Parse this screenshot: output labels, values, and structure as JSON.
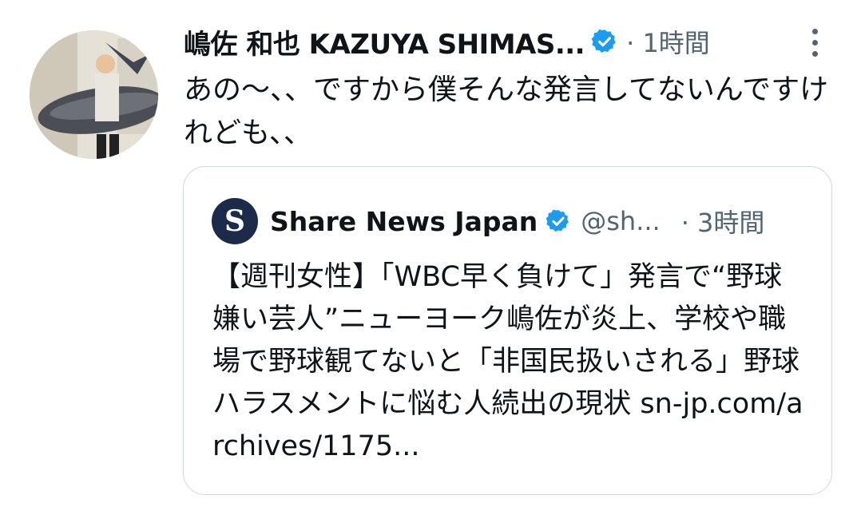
{
  "tweet": {
    "author_name": "嶋佐 和也 KAZUYA SHIMAS...",
    "time": "· 1時間",
    "text": "あの〜、、ですから僕そんな発言してないんですけれども、、",
    "avatar_icon": "profile-photo-avatar",
    "verified_icon": "verified-badge-icon",
    "more_icon": "more-options-icon"
  },
  "quote": {
    "author_name": "Share News Japan",
    "handle": "@sh...",
    "time": "· 3時間",
    "text": "【週刊女性】「WBC早く負けて」発言で“野球嫌い芸人”ニューヨーク嶋佐が炎上、学校や職場で野球観てないと「非国民扱いされる」野球ハラスメントに悩む人続出の現状 sn-jp.com/archives/1175...",
    "logo_letter": "S"
  },
  "colors": {
    "verified": "#1d9bf0",
    "secondary_text": "#536471",
    "border": "#cfd9de",
    "logo_bg": "#1c2b4a"
  }
}
